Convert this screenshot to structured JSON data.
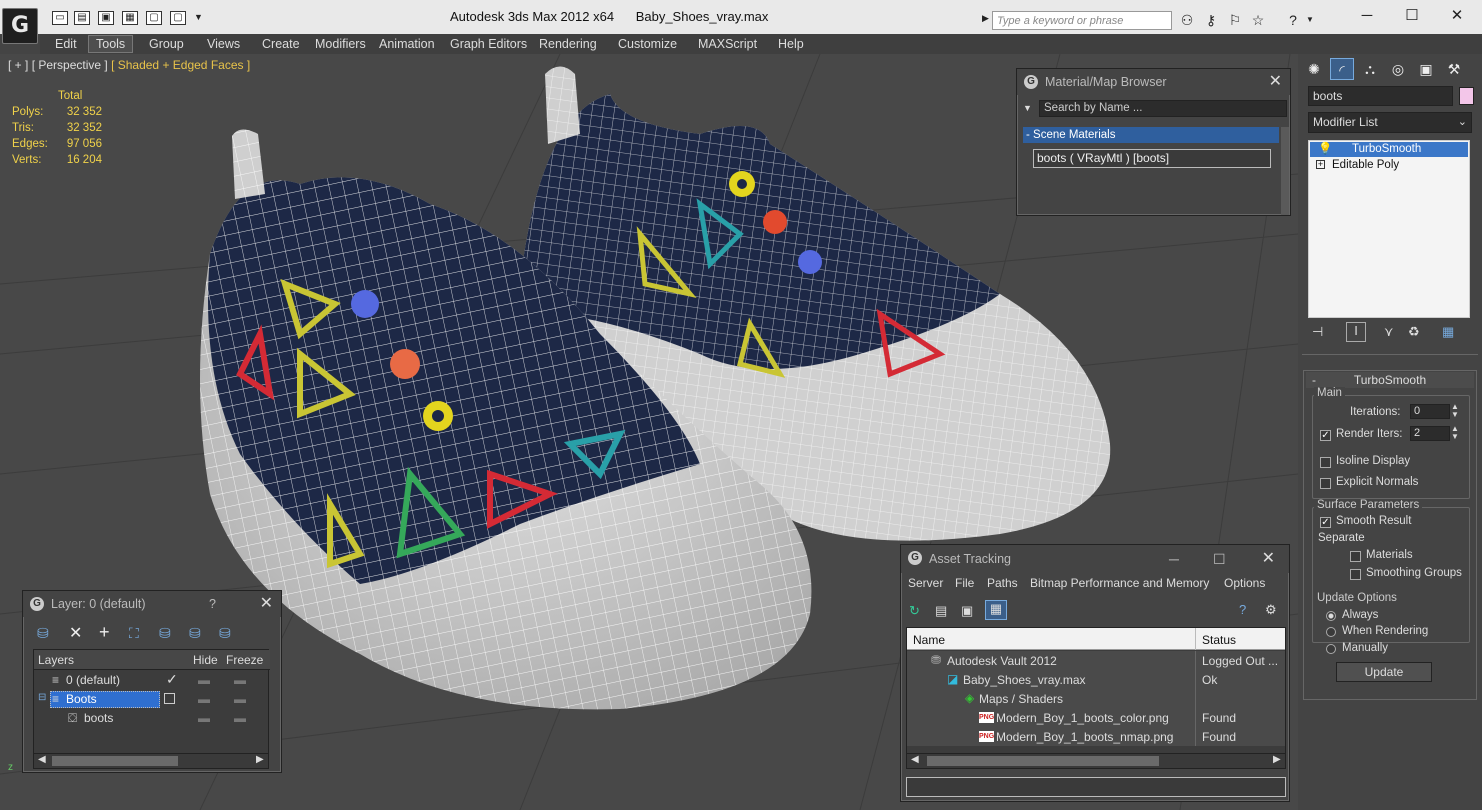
{
  "titlebar": {
    "app_title": "Autodesk 3ds Max  2012 x64",
    "file_name": "Baby_Shoes_vray.max",
    "search_placeholder": "Type a keyword or phrase",
    "logo_glyph": "G",
    "minimize": "─",
    "maximize": "☐",
    "close": "✕"
  },
  "menubar": {
    "items": [
      "Edit",
      "Tools",
      "Group",
      "Views",
      "Create",
      "Modifiers",
      "Animation",
      "Graph Editors",
      "Rendering",
      "Customize",
      "MAXScript",
      "Help"
    ],
    "active": "Tools"
  },
  "viewport": {
    "label_parts": [
      "[ + ]",
      "[ Perspective ]",
      "[ Shaded + Edged Faces ]"
    ],
    "stats": {
      "header": "Total",
      "rows": [
        {
          "label": "Polys:",
          "value": "32 352"
        },
        {
          "label": "Tris:",
          "value": "32 352"
        },
        {
          "label": "Edges:",
          "value": "97 056"
        },
        {
          "label": "Verts:",
          "value": "16 204"
        }
      ]
    },
    "colors": {
      "background": "#484848",
      "sole": "#d8d8d8",
      "fabric": "#1e2a4a",
      "wire": "#ffffff"
    }
  },
  "material_browser": {
    "title": "Material/Map Browser",
    "search_placeholder": "Search by Name ...",
    "section": "- Scene Materials",
    "item": "boots  ( VRayMtl ) [boots]"
  },
  "layer_panel": {
    "title": "Layer: 0 (default)",
    "help": "?",
    "columns": [
      "Layers",
      "Hide",
      "Freeze"
    ],
    "rows": [
      {
        "name": "0 (default)",
        "checked": true
      },
      {
        "name": "Boots",
        "selected": true
      },
      {
        "name": "boots"
      }
    ]
  },
  "asset_tracking": {
    "title": "Asset Tracking",
    "menus": [
      "Server",
      "File",
      "Paths",
      "Bitmap Performance and Memory",
      "Options"
    ],
    "columns": [
      "Name",
      "Status"
    ],
    "rows": [
      {
        "name": "Autodesk Vault 2012",
        "status": "Logged Out ..."
      },
      {
        "name": "Baby_Shoes_vray.max",
        "status": "Ok"
      },
      {
        "name": "Maps / Shaders",
        "status": ""
      },
      {
        "name": "Modern_Boy_1_boots_color.png",
        "status": "Found"
      },
      {
        "name": "Modern_Boy_1_boots_nmap.png",
        "status": "Found"
      }
    ]
  },
  "command_panel": {
    "object_name": "boots",
    "object_color": "#f3c6e9",
    "modifier_list": "Modifier List",
    "stack": [
      "TurboSmooth",
      "Editable Poly"
    ],
    "rollout_title": "TurboSmooth",
    "main_group": "Main",
    "iterations_label": "Iterations:",
    "iterations_value": "0",
    "render_iters_label": "Render Iters:",
    "render_iters_value": "2",
    "isoline_display": "Isoline Display",
    "explicit_normals": "Explicit Normals",
    "surface_params": "Surface Parameters",
    "smooth_result": "Smooth Result",
    "separate": "Separate",
    "materials": "Materials",
    "smoothing_groups": "Smoothing Groups",
    "update_options": "Update Options",
    "always": "Always",
    "when_rendering": "When Rendering",
    "manually": "Manually",
    "update_button": "Update"
  }
}
